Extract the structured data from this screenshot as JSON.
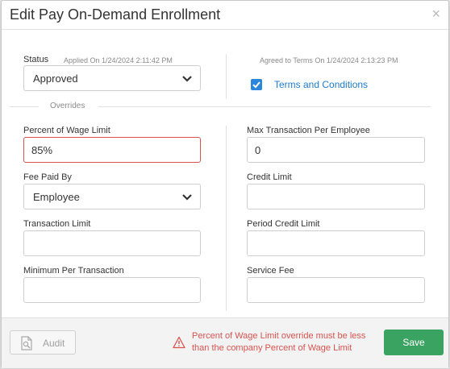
{
  "modal": {
    "title": "Edit Pay On-Demand Enrollment",
    "close_glyph": "×"
  },
  "status": {
    "label": "Status",
    "applied_text": "Applied On 1/24/2024 2:11:42 PM",
    "value": "Approved"
  },
  "terms": {
    "agreed_text": "Agreed to Terms On 1/24/2024 2:13:23 PM",
    "link_label": "Terms and Conditions",
    "checked": true
  },
  "overrides": {
    "section_label": "Overrides",
    "percent_wage_limit": {
      "label": "Percent of Wage Limit",
      "value": "85%"
    },
    "fee_paid_by": {
      "label": "Fee Paid By",
      "value": "Employee"
    },
    "transaction_limit": {
      "label": "Transaction Limit",
      "value": ""
    },
    "minimum_per_transaction": {
      "label": "Minimum Per Transaction",
      "value": ""
    },
    "max_transaction_per_employee": {
      "label": "Max Transaction Per Employee",
      "value": "0"
    },
    "credit_limit": {
      "label": "Credit Limit",
      "value": ""
    },
    "period_credit_limit": {
      "label": "Period Credit Limit",
      "value": ""
    },
    "service_fee": {
      "label": "Service Fee",
      "value": ""
    }
  },
  "footer": {
    "audit_label": "Audit",
    "error_message": "Percent of Wage Limit override must be less than the company Percent of Wage Limit",
    "save_label": "Save"
  },
  "colors": {
    "accent": "#2c86d9",
    "link": "#1f7ac9",
    "error": "#d9534f",
    "save": "#3aa361"
  }
}
